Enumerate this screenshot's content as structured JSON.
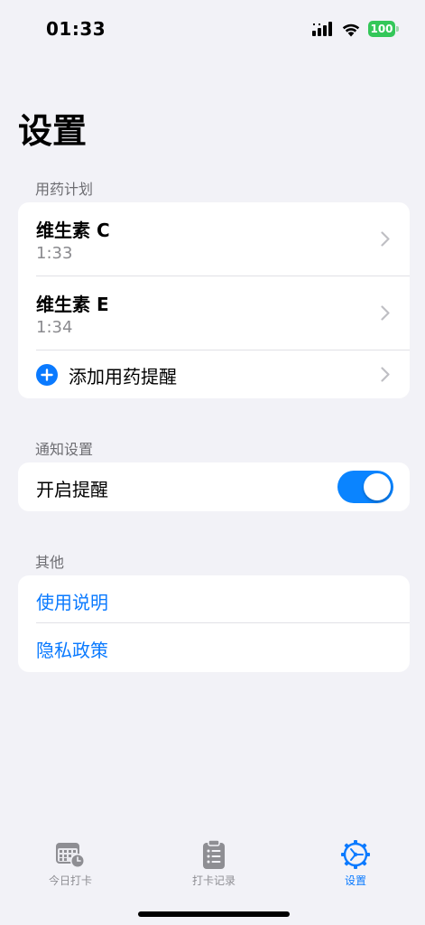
{
  "status_bar": {
    "time": "01:33",
    "battery": "100"
  },
  "page": {
    "title": "设置"
  },
  "sections": {
    "plan": {
      "header": "用药计划",
      "items": [
        {
          "name": "维生素 C",
          "time": "1:33"
        },
        {
          "name": "维生素 E",
          "time": "1:34"
        }
      ],
      "add_label": "添加用药提醒"
    },
    "notifications": {
      "header": "通知设置",
      "toggle_label": "开启提醒",
      "toggle_on": true
    },
    "other": {
      "header": "其他",
      "links": [
        "使用说明",
        "隐私政策"
      ]
    }
  },
  "tab_bar": {
    "tabs": [
      {
        "label": "今日打卡",
        "icon": "calendar-clock-icon",
        "active": false
      },
      {
        "label": "打卡记录",
        "icon": "clipboard-list-icon",
        "active": false
      },
      {
        "label": "设置",
        "icon": "gear-icon",
        "active": true
      }
    ]
  },
  "colors": {
    "accent": "#0A7AFF",
    "background": "#F2F2F7",
    "battery": "#34C759",
    "inactive_tab": "#8E8E93"
  }
}
